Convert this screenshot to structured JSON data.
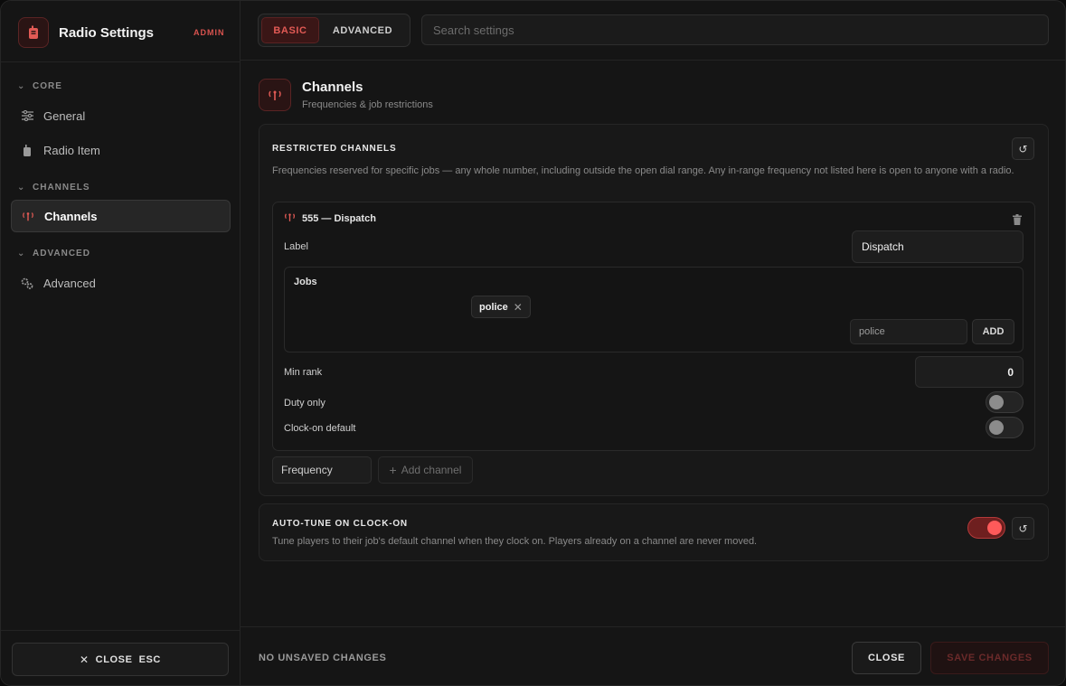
{
  "app": {
    "title": "Radio Settings",
    "badge": "ADMIN"
  },
  "sidebar": {
    "sections": [
      {
        "label": "CORE",
        "items": [
          {
            "label": "General",
            "icon": "sliders-icon"
          },
          {
            "label": "Radio Item",
            "icon": "radio-icon"
          }
        ]
      },
      {
        "label": "CHANNELS",
        "items": [
          {
            "label": "Channels",
            "icon": "antenna-icon",
            "active": true
          }
        ]
      },
      {
        "label": "ADVANCED",
        "items": [
          {
            "label": "Advanced",
            "icon": "gears-icon"
          }
        ]
      }
    ],
    "close_label": "CLOSE",
    "close_key": "ESC"
  },
  "topbar": {
    "tabs": [
      {
        "label": "BASIC",
        "active": true
      },
      {
        "label": "ADVANCED",
        "active": false
      }
    ],
    "search_placeholder": "Search settings"
  },
  "page": {
    "title": "Channels",
    "subtitle": "Frequencies & job restrictions"
  },
  "restricted": {
    "title": "RESTRICTED CHANNELS",
    "description": "Frequencies reserved for specific jobs — any whole number, including outside the open dial range. Any in-range frequency not listed here is open to anyone with a radio.",
    "channel": {
      "header": "555 — Dispatch",
      "label_field_label": "Label",
      "label_value": "Dispatch",
      "jobs_label": "Jobs",
      "job_chips": [
        "police"
      ],
      "job_input_value": "police",
      "add_label": "ADD",
      "min_rank_label": "Min rank",
      "min_rank_value": "0",
      "duty_only_label": "Duty only",
      "duty_only_on": false,
      "clock_on_default_label": "Clock-on default",
      "clock_on_default_on": false
    },
    "frequency_placeholder": "Frequency",
    "add_channel_label": "Add channel"
  },
  "autotune": {
    "title": "AUTO-TUNE ON CLOCK-ON",
    "description": "Tune players to their job's default channel when they clock on. Players already on a channel are never moved.",
    "enabled": true
  },
  "footer": {
    "status": "NO UNSAVED CHANGES",
    "close_label": "CLOSE",
    "save_label": "SAVE CHANGES"
  },
  "colors": {
    "accent": "#e25a55",
    "background": "#151515",
    "card": "#181818"
  }
}
